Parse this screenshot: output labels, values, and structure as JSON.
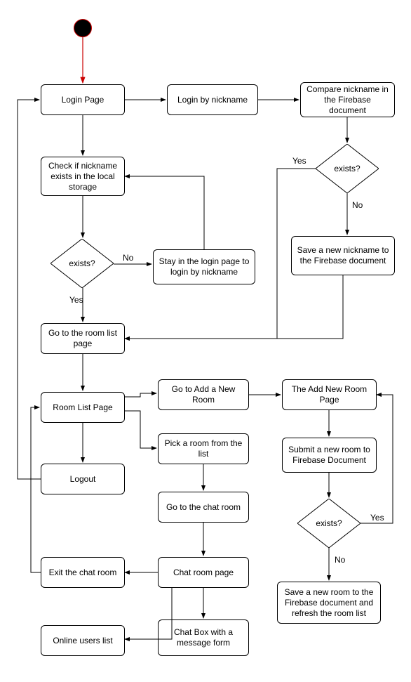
{
  "nodes": {
    "login_page": "Login Page",
    "login_by_nickname": "Login by nickname",
    "compare_nickname": "Compare nickname in the Firebase document",
    "check_local": "Check if nickname exists in the local storage",
    "stay_login": "Stay in the login page to login by nickname",
    "save_nickname": "Save a new nickname to the Firebase document",
    "go_room_list": "Go  to the room list page",
    "room_list_page": "Room List Page",
    "go_add_new_room": "Go to Add a New Room",
    "add_new_room_page": "The Add New Room Page",
    "pick_room": "Pick a room from the list",
    "submit_room": "Submit a new room to Firebase Document",
    "logout": "Logout",
    "go_chat_room": "Go to the chat room",
    "chat_room_page": "Chat room page",
    "exit_chat_room": "Exit the chat room",
    "save_room": "Save a new room to the Firebase document and refresh the room list",
    "online_users": "Online users list",
    "chat_box": "Chat Box with a message form"
  },
  "decisions": {
    "exists1": "exists?",
    "exists2": "exists?",
    "exists3": "exists?"
  },
  "edges": {
    "yes": "Yes",
    "no": "No"
  }
}
